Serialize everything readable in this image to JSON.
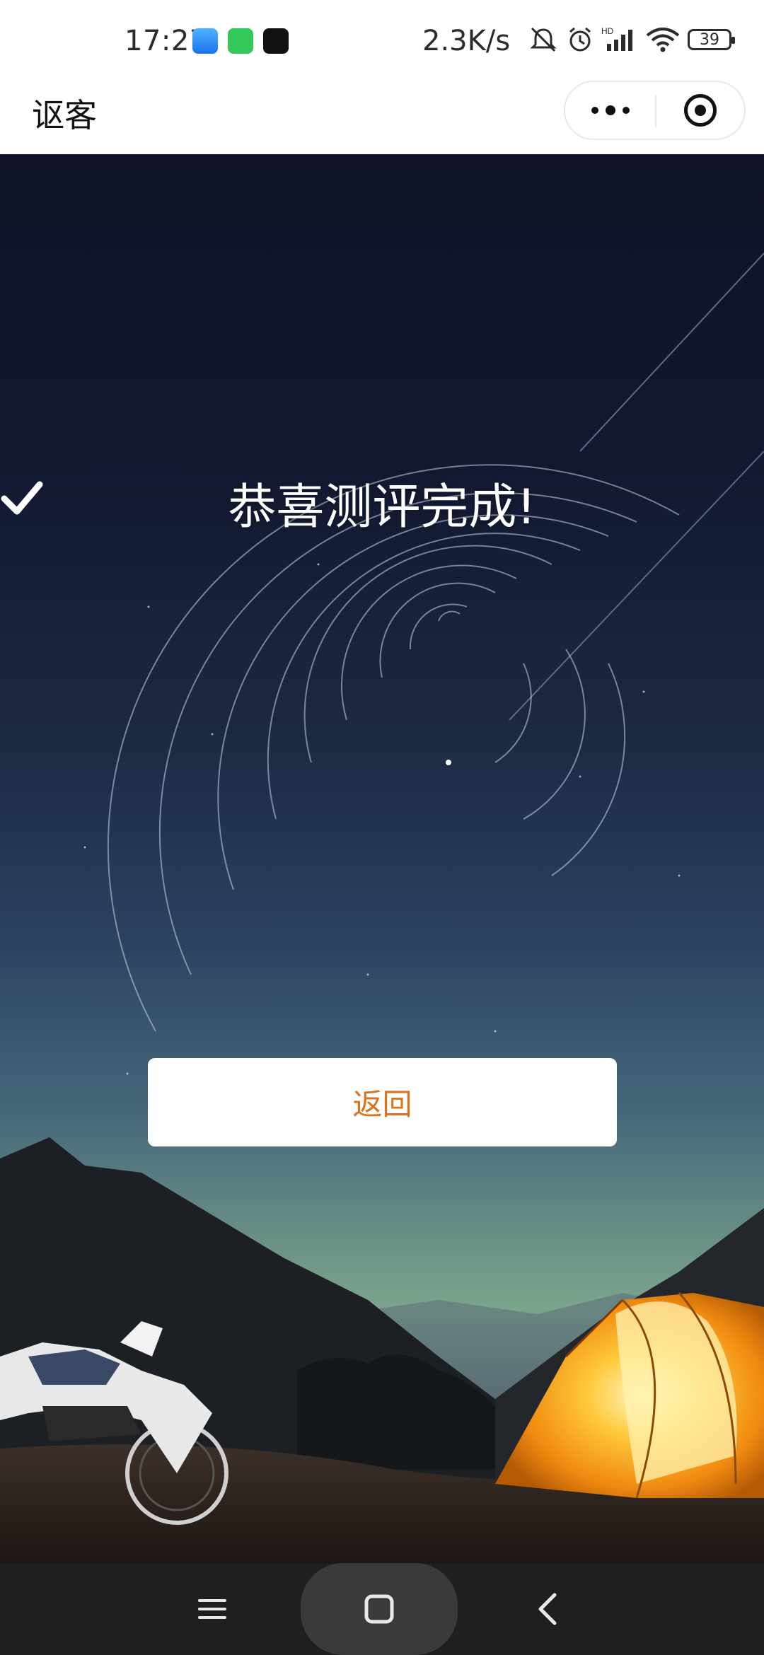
{
  "status_bar": {
    "time": "17:27",
    "net_speed": "2.3K/s",
    "battery_level": "39",
    "app_icons": [
      "blue-app-icon",
      "green-cat-app-icon",
      "astar-app-icon"
    ],
    "indicators": [
      "mute-bell-icon",
      "alarm-icon",
      "hd-signal-icon",
      "wifi-icon",
      "battery-icon"
    ]
  },
  "title_bar": {
    "title": "讴客",
    "capsule_icons": [
      "more-dots-icon",
      "close-miniprogram-icon"
    ]
  },
  "main": {
    "headline": "恭喜测评完成!",
    "headline_icon": "checkmark-icon",
    "back_button": "返回",
    "colors": {
      "button_text": "#d9731f",
      "button_bg": "#ffffff",
      "headline_text": "#ffffff"
    },
    "background": "night-sky-camping-photo"
  },
  "nav_bar": {
    "buttons": [
      "menu-icon",
      "home-icon",
      "back-icon"
    ]
  }
}
